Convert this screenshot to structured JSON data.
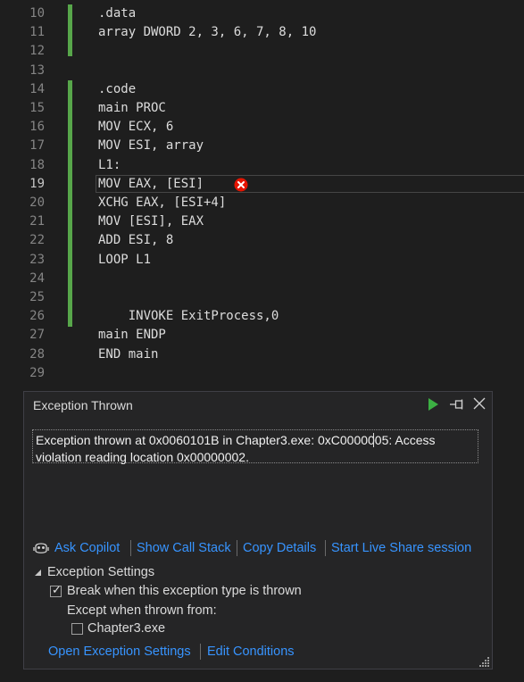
{
  "editor": {
    "lines": [
      {
        "num": "10",
        "text": ".data"
      },
      {
        "num": "11",
        "text": "array DWORD 2, 3, 6, 7, 8, 10"
      },
      {
        "num": "12",
        "text": ""
      },
      {
        "num": "13",
        "text": ""
      },
      {
        "num": "14",
        "text": ".code"
      },
      {
        "num": "15",
        "text": "main PROC"
      },
      {
        "num": "16",
        "text": "MOV ECX, 6"
      },
      {
        "num": "17",
        "text": "MOV ESI, array"
      },
      {
        "num": "18",
        "text": "L1:"
      },
      {
        "num": "19",
        "text": "MOV EAX, [ESI]"
      },
      {
        "num": "20",
        "text": "XCHG EAX, [ESI+4]"
      },
      {
        "num": "21",
        "text": "MOV [ESI], EAX"
      },
      {
        "num": "22",
        "text": "ADD ESI, 8"
      },
      {
        "num": "23",
        "text": "LOOP L1"
      },
      {
        "num": "24",
        "text": ""
      },
      {
        "num": "25",
        "text": ""
      },
      {
        "num": "26",
        "text": "    INVOKE ExitProcess,0"
      },
      {
        "num": "27",
        "text": "main ENDP"
      },
      {
        "num": "28",
        "text": "END main"
      },
      {
        "num": "29",
        "text": ""
      }
    ],
    "current_line": "19"
  },
  "popup": {
    "title": "Exception Thrown",
    "message": "Exception thrown at 0x0060101B in Chapter3.exe: 0xC0000005: Access violation reading location 0x00000002.",
    "links": {
      "ask_copilot": "Ask Copilot",
      "show_call_stack": "Show Call Stack",
      "copy_details": "Copy Details",
      "live_share": "Start Live Share session"
    },
    "settings": {
      "header": "Exception Settings",
      "break_label": "Break when this exception type is thrown",
      "break_checked": true,
      "except_label": "Except when thrown from:",
      "module_label": "Chapter3.exe",
      "module_checked": false
    },
    "bottom_links": {
      "open_settings": "Open Exception Settings",
      "edit_conditions": "Edit Conditions"
    }
  },
  "colors": {
    "accent_link": "#3794ff",
    "change_bar": "#57a64a",
    "error": "#e51400",
    "run_green": "#3cb043"
  }
}
